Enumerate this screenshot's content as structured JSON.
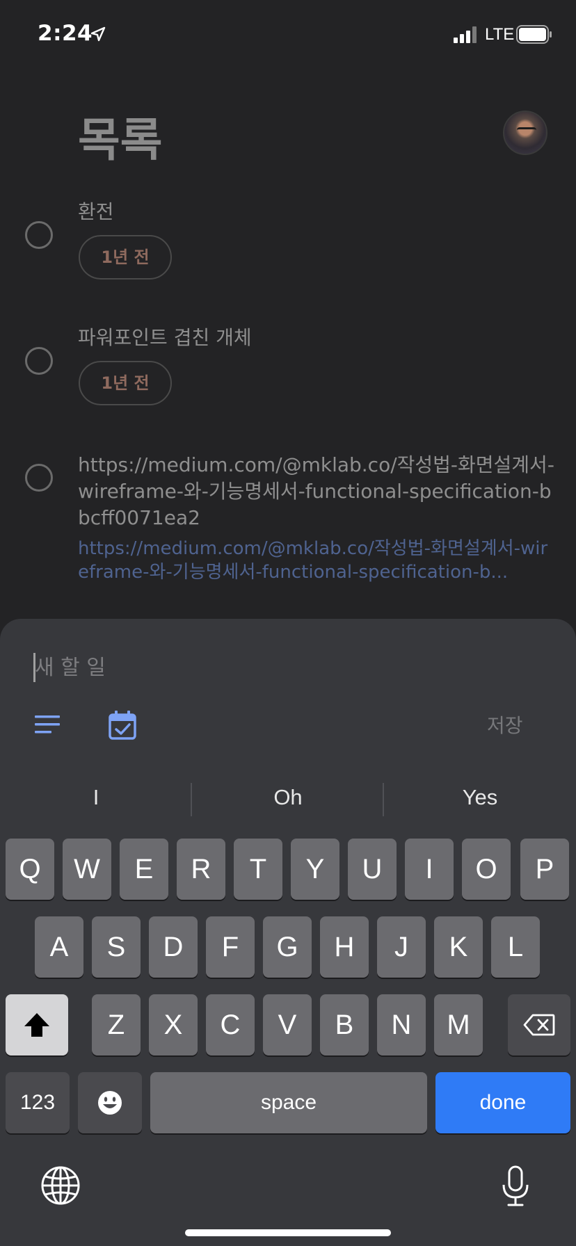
{
  "status_bar": {
    "time": "2:24",
    "network": "LTE",
    "icons": [
      "location-arrow-icon",
      "signal-icon",
      "battery-icon"
    ]
  },
  "list": {
    "title": "목록",
    "tasks": [
      {
        "title": "환전",
        "date_chip": "1년 전"
      },
      {
        "title": "파워포인트 겹친 개체",
        "date_chip": "1년 전"
      },
      {
        "title": "https://medium.com/@mklab.co/작성법-화면설계서-wireframe-와-기능명세서-functional-specification-bbcff0071ea2",
        "link": "https://medium.com/@mklab.co/작성법-화면설계서-wireframe-와-기능명세서-functional-specification-b..."
      }
    ]
  },
  "sheet": {
    "input_placeholder": "새 할 일",
    "input_value": "",
    "save_label": "저장",
    "icons": [
      "details-icon",
      "calendar-icon"
    ]
  },
  "keyboard": {
    "suggestions": [
      "I",
      "Oh",
      "Yes"
    ],
    "row1": [
      "Q",
      "W",
      "E",
      "R",
      "T",
      "Y",
      "U",
      "I",
      "O",
      "P"
    ],
    "row2": [
      "A",
      "S",
      "D",
      "F",
      "G",
      "H",
      "J",
      "K",
      "L"
    ],
    "row3": [
      "Z",
      "X",
      "C",
      "V",
      "B",
      "N",
      "M"
    ],
    "numbers_label": "123",
    "space_label": "space",
    "done_label": "done"
  },
  "colors": {
    "background": "#232325",
    "sheet": "#37383c",
    "accent_blue": "#7ea3f5",
    "done_key": "#2f7bf6"
  }
}
